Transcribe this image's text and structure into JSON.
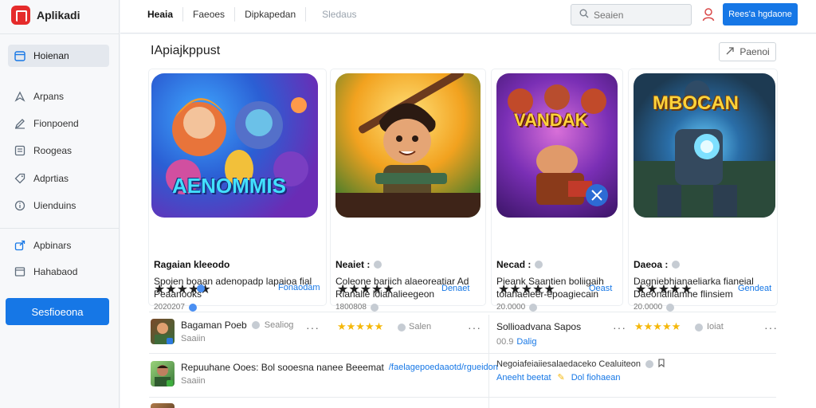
{
  "app": {
    "name": "Aplikadi",
    "brand_color": "#e52b2b",
    "accent": "#1677e6"
  },
  "sidebar": {
    "items": [
      {
        "label": "Hoienan",
        "icon": "calendar-icon",
        "active": true
      },
      {
        "label": "Arpans",
        "icon": "compass-icon"
      },
      {
        "label": "Fionpoend",
        "icon": "edit-icon"
      },
      {
        "label": "Roogeas",
        "icon": "list-icon"
      },
      {
        "label": "Adprtias",
        "icon": "tag-icon"
      },
      {
        "label": "Uienduins",
        "icon": "info-icon"
      },
      {
        "label": "Apbinars",
        "icon": "share-icon"
      },
      {
        "label": "Hahabaod",
        "icon": "window-icon"
      }
    ],
    "cta_label": "Sesfioeona"
  },
  "header": {
    "nav": [
      "Heaia",
      "Faeoes",
      "Dipkapedan"
    ],
    "nav_muted": "Sledaus",
    "search_placeholder": "Seaien",
    "button_label": "Rees'a hgdaone"
  },
  "main": {
    "title": "IApiajkppust",
    "title_button": "Paenoi",
    "cards": [
      {
        "art_text": "AENOMMIS",
        "name": "Ragaian kleeodo",
        "desc": "Spoien boaan adenopadp lapaioa fial Peaanooks",
        "meta": "2020207",
        "stars": "★★★★★",
        "link": "Fonaodam"
      },
      {
        "art_text": "",
        "name": "Neaiet :",
        "desc": "Coleone bariich alaeoreatiar Ad Rianalie loianalieegeon",
        "meta": "1800808",
        "stars": "★★★★★",
        "link": "Denaet"
      },
      {
        "art_text": "VANDAK",
        "name": "Necad :",
        "desc": "Pieank Saantien boliigaih tolanaeleer-epoagiecain",
        "meta": "20.0000",
        "stars": "★★★★★",
        "link": "Oeast"
      },
      {
        "art_text": "MBOCAN",
        "name": "Daeoa :",
        "desc": "Dagniebhianaeliarka fianeial Daeonafiiamhe flinsiem",
        "meta": "20.0000",
        "stars": "★★★★★",
        "link": "Gendeat"
      }
    ],
    "list": [
      {
        "title": "Bagaman Poeb",
        "extra": "Sealiog",
        "sub": "Saaiin",
        "mid_stars": "★★★★★",
        "mid_label": "Salen",
        "right_title": "Sollioadvana Sapos",
        "right_sub": "00.9",
        "right_link": "Dalig",
        "right_stars": "★★★★★",
        "right_label": "Ioiat"
      },
      {
        "title": "Repuuhane Ooes: Bol sooesna nanee Beeemat",
        "link": "/faelagepoedaaotd/rgueidon",
        "sub": "Saaiin",
        "right_title": "Negoiafeiaiiesalaedaceko Cealuiteon",
        "right_link": "Aneeht beetat",
        "right_link2": "Dol fiohaean"
      }
    ]
  }
}
